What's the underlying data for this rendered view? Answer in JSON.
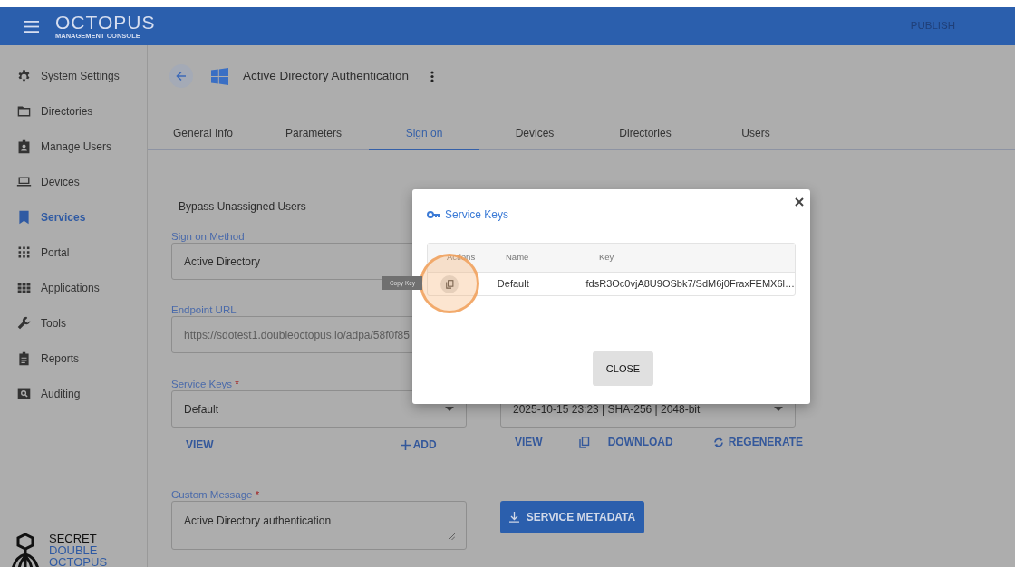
{
  "header": {
    "brand": "OCTOPUS",
    "brand_subtitle": "MANAGEMENT CONSOLE",
    "publish": "PUBLISH"
  },
  "sidebar": {
    "items": [
      {
        "label": "System Settings",
        "selected": false
      },
      {
        "label": "Directories",
        "selected": false
      },
      {
        "label": "Manage Users",
        "selected": false
      },
      {
        "label": "Devices",
        "selected": false
      },
      {
        "label": "Services",
        "selected": true
      },
      {
        "label": "Portal",
        "selected": false
      },
      {
        "label": "Applications",
        "selected": false
      },
      {
        "label": "Tools",
        "selected": false
      },
      {
        "label": "Reports",
        "selected": false
      },
      {
        "label": "Auditing",
        "selected": false
      }
    ],
    "logo": [
      "SECRET",
      "DOUBLE",
      "OCTOPUS"
    ]
  },
  "page": {
    "title": "Active Directory Authentication"
  },
  "tabs": [
    {
      "label": "General Info",
      "selected": false
    },
    {
      "label": "Parameters",
      "selected": false
    },
    {
      "label": "Sign on",
      "selected": true
    },
    {
      "label": "Devices",
      "selected": false
    },
    {
      "label": "Directories",
      "selected": false
    },
    {
      "label": "Users",
      "selected": false
    }
  ],
  "form": {
    "bypass_label": "Bypass Unassigned Users",
    "sign_on_method": {
      "label": "Sign on Method",
      "value": "Active Directory"
    },
    "endpoint_url": {
      "label": "Endpoint URL",
      "value": "https://sdotest1.doubleoctopus.io/adpa/58f0f85"
    },
    "service_keys": {
      "label": "Service Keys",
      "required_mark": "*",
      "value": "Default"
    },
    "service_keys_actions": [
      {
        "label": "VIEW",
        "kind": "text"
      },
      {
        "label": "ADD",
        "kind": "add"
      }
    ],
    "certificate": {
      "value": "2025-10-15 23:23 | SHA-256 | 2048-bit"
    },
    "certificate_actions": [
      {
        "label": "VIEW",
        "kind": "text"
      },
      {
        "kind": "copy"
      },
      {
        "label": "DOWNLOAD",
        "kind": "text"
      },
      {
        "label": "REGENERATE",
        "kind": "regenerate"
      }
    ],
    "custom_message": {
      "label": "Custom Message",
      "required_mark": "*",
      "value": "Active Directory authentication"
    },
    "metadata_button": "SERVICE METADATA"
  },
  "dialog": {
    "title": "Service Keys",
    "columns": [
      "Actions",
      "Name",
      "Key"
    ],
    "rows": [
      {
        "name": "Default",
        "key": "fdsR3Oc0vjA8U9OSbk7/SdM6j0FraxFEMX6l…"
      }
    ],
    "close": "CLOSE"
  },
  "tooltip": "Copy Key"
}
